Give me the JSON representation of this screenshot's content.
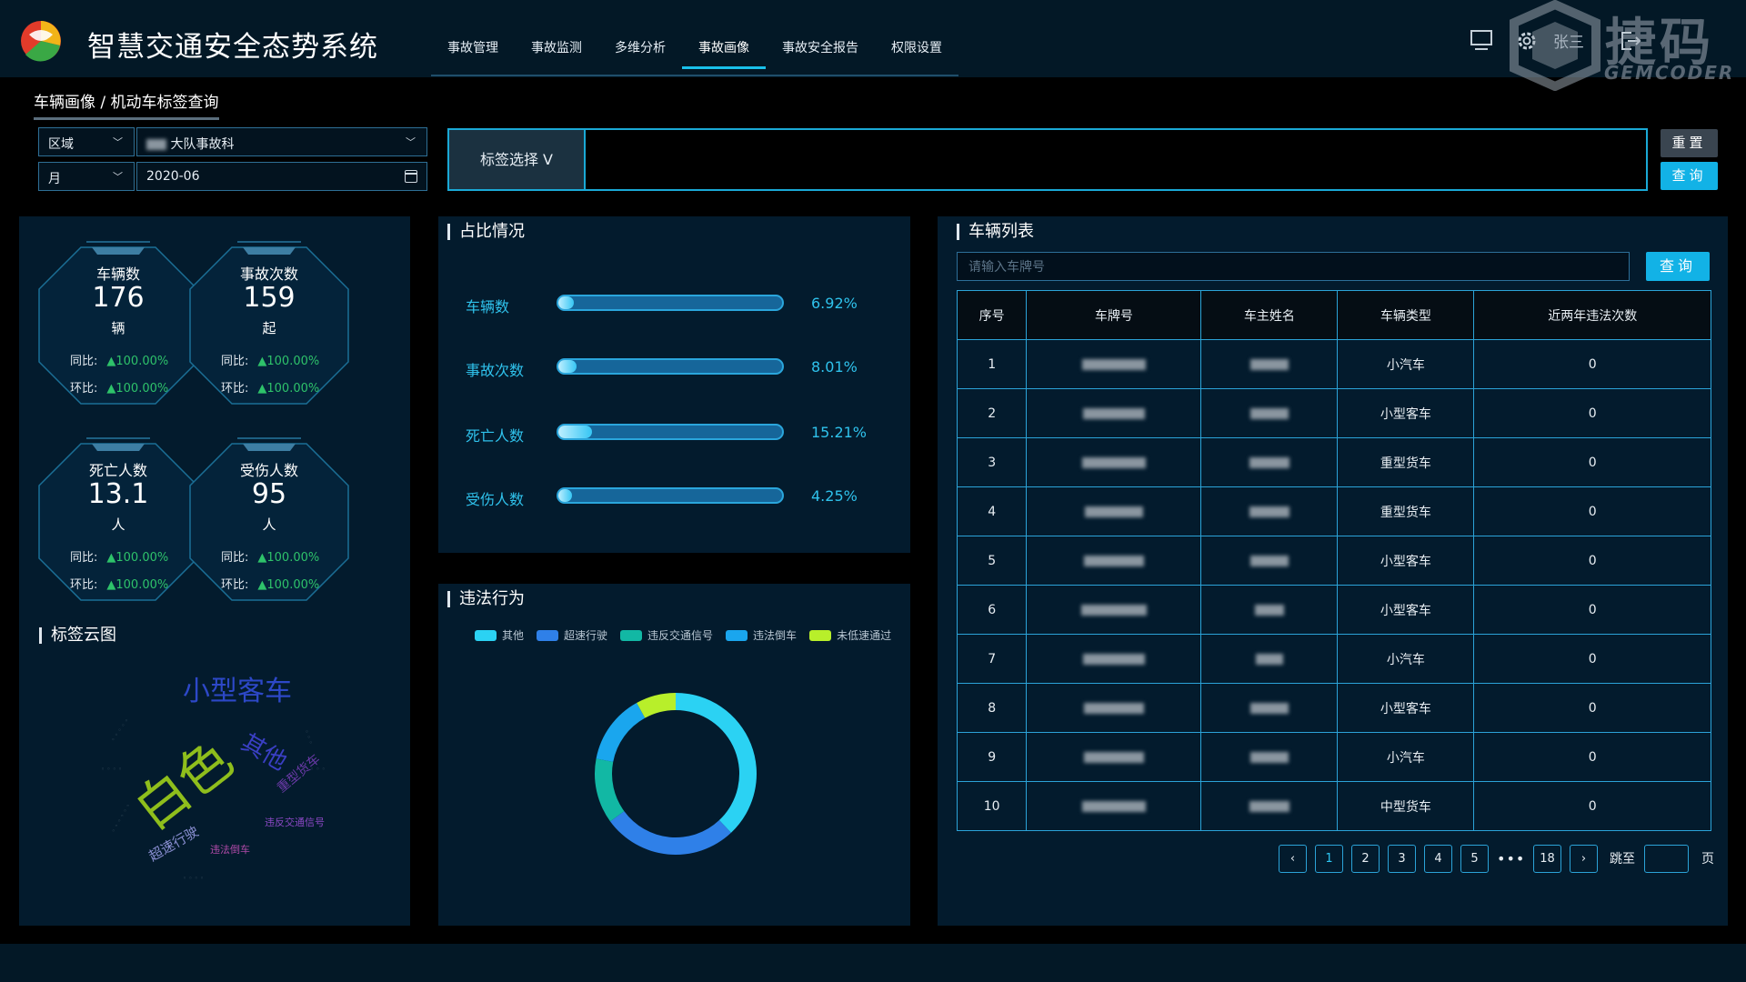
{
  "header": {
    "app_title": "智慧交通安全态势系统",
    "nav": [
      "事故管理",
      "事故监测",
      "多维分析",
      "事故画像",
      "事故安全报告",
      "权限设置"
    ],
    "active_nav": 3,
    "user": "张三",
    "watermark_main": "捷码",
    "watermark_sub": "GEMCODER"
  },
  "breadcrumb": "车辆画像 / 机动车标签查询",
  "filters": {
    "area_label": "区域",
    "area_value": "大队事故科",
    "period_label": "月",
    "date_value": "2020-06",
    "tag_button": "标签选择 V",
    "reset_label": "重置",
    "query_label": "查询"
  },
  "stats": [
    {
      "label": "车辆数",
      "value": "176",
      "unit": "辆",
      "yoy_label": "同比:",
      "yoy": "100.00%",
      "mom_label": "环比:",
      "mom": "100.00%"
    },
    {
      "label": "事故次数",
      "value": "159",
      "unit": "起",
      "yoy_label": "同比:",
      "yoy": "100.00%",
      "mom_label": "环比:",
      "mom": "100.00%"
    },
    {
      "label": "死亡人数",
      "value": "13.1",
      "unit": "人",
      "yoy_label": "同比:",
      "yoy": "100.00%",
      "mom_label": "环比:",
      "mom": "100.00%"
    },
    {
      "label": "受伤人数",
      "value": "95",
      "unit": "人",
      "yoy_label": "同比:",
      "yoy": "100.00%",
      "mom_label": "环比:",
      "mom": "100.00%"
    }
  ],
  "tag_cloud": {
    "title": "标签云图",
    "words": [
      "小型客车",
      "白色",
      "其他",
      "超速行驶",
      "违法倒车",
      "违反交通信号",
      "重型货车"
    ]
  },
  "ratio": {
    "title": "占比情况",
    "rows": [
      {
        "label": "车辆数",
        "value": "6.92%",
        "fraction": 0.0692
      },
      {
        "label": "事故次数",
        "value": "8.01%",
        "fraction": 0.0801
      },
      {
        "label": "死亡人数",
        "value": "15.21%",
        "fraction": 0.1521
      },
      {
        "label": "受伤人数",
        "value": "4.25%",
        "fraction": 0.0425
      }
    ]
  },
  "violations": {
    "title": "违法行为",
    "legend": [
      {
        "name": "其他",
        "color": "#2bd2f3"
      },
      {
        "name": "超速行驶",
        "color": "#2f80e8"
      },
      {
        "name": "违反交通信号",
        "color": "#12b8a4"
      },
      {
        "name": "违法倒车",
        "color": "#1aa6ee"
      },
      {
        "name": "未低速通过",
        "color": "#b8ef2a"
      }
    ]
  },
  "chart_data": {
    "type": "pie",
    "title": "违法行为",
    "series": [
      {
        "name": "其他",
        "value": 38
      },
      {
        "name": "超速行驶",
        "value": 27
      },
      {
        "name": "违反交通信号",
        "value": 13
      },
      {
        "name": "违法倒车",
        "value": 14
      },
      {
        "name": "未低速通过",
        "value": 8
      }
    ]
  },
  "vehicle_list": {
    "title": "车辆列表",
    "search_placeholder": "请输入车牌号",
    "query_label": "查询",
    "columns": [
      "序号",
      "车牌号",
      "车主姓名",
      "车辆类型",
      "近两年违法次数"
    ],
    "rows": [
      {
        "no": "1",
        "type": "小汽车",
        "count": "0"
      },
      {
        "no": "2",
        "type": "小型客车",
        "count": "0"
      },
      {
        "no": "3",
        "type": "重型货车",
        "count": "0"
      },
      {
        "no": "4",
        "type": "重型货车",
        "count": "0"
      },
      {
        "no": "5",
        "type": "小型客车",
        "count": "0"
      },
      {
        "no": "6",
        "type": "小型客车",
        "count": "0"
      },
      {
        "no": "7",
        "type": "小汽车",
        "count": "0"
      },
      {
        "no": "8",
        "type": "小型客车",
        "count": "0"
      },
      {
        "no": "9",
        "type": "小汽车",
        "count": "0"
      },
      {
        "no": "10",
        "type": "中型货车",
        "count": "0"
      }
    ],
    "pager": {
      "pages": [
        "1",
        "2",
        "3",
        "4",
        "5"
      ],
      "dots": "•••",
      "last": "18",
      "current": "1",
      "jump_label": "跳至",
      "page_label": "页",
      "prev": "‹",
      "next": "›"
    }
  }
}
